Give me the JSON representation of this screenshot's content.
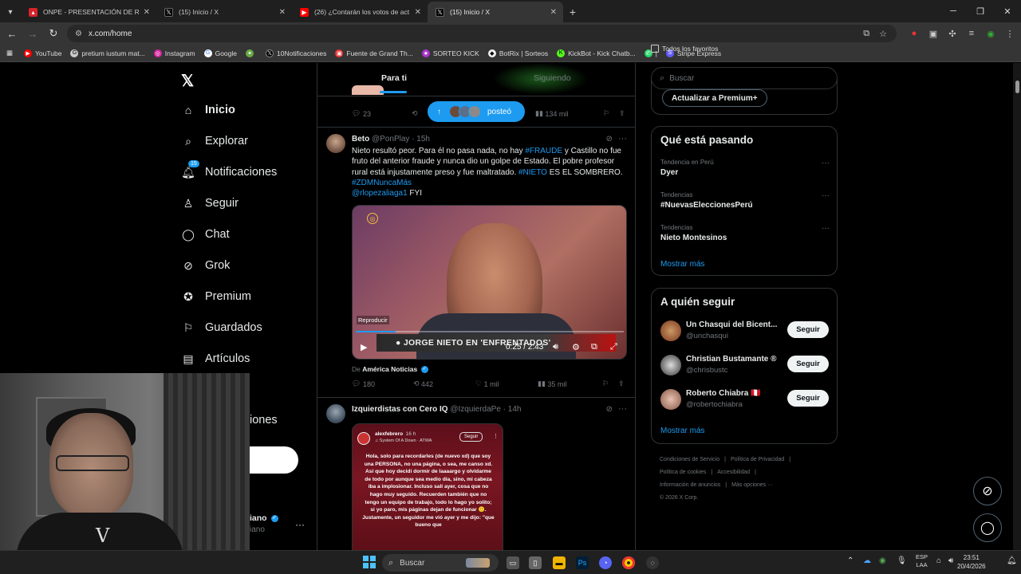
{
  "browser": {
    "tabs": [
      {
        "title": "ONPE - PRESENTACIÓN DE RES",
        "color": "#d8232a"
      },
      {
        "title": "(15) Inicio / X",
        "color": "#000000"
      },
      {
        "title": "(26) ¿Contarán los votos de act",
        "color": "#ff0000"
      },
      {
        "title": "(15) Inicio / X",
        "color": "#000000"
      }
    ],
    "active_tab": 3,
    "url": "x.com/home",
    "bookmarks": [
      "YouTube",
      "pretium iustum mat...",
      "Instagram",
      "Google",
      "",
      "10Notificaciones",
      "Fuente de Grand Th...",
      "SORTEO KICK",
      "BotRix | Sorteos",
      "KickBot - Kick Chatb...",
      "|",
      "Stripe Express"
    ],
    "all_bookmarks": "Todos los favoritos"
  },
  "nav": {
    "items": [
      {
        "label": "Inicio",
        "icon": "home-icon"
      },
      {
        "label": "Explorar",
        "icon": "search-icon"
      },
      {
        "label": "Notificaciones",
        "icon": "bell-icon"
      },
      {
        "label": "Seguir",
        "icon": "follow-icon"
      },
      {
        "label": "Chat",
        "icon": "chat-icon"
      },
      {
        "label": "Grok",
        "icon": "grok-icon"
      },
      {
        "label": "Premium",
        "icon": "premium-icon"
      },
      {
        "label": "Guardados",
        "icon": "bookmark-icon"
      },
      {
        "label": "Artículos",
        "icon": "articles-icon"
      },
      {
        "label": "iones",
        "icon": ""
      }
    ],
    "notif_badge": "15",
    "user_name_fragment": "iano",
    "user_handle_fragment": "iano"
  },
  "feed": {
    "tabs": [
      "Para ti",
      "Siguiendo"
    ],
    "prev_actions": {
      "replies": "23",
      "views": "134 mil"
    },
    "posted_pill": "posteó",
    "tweet1": {
      "name": "Beto",
      "handle": "@PonPlay · 15h",
      "text_1": "Nieto resultó peor. Para él no pasa nada, no hay ",
      "tag_1": "#FRAUDE",
      "text_2": " y Castillo no fue fruto del anterior fraude y nunca dio un golpe de Estado. El pobre profesor rural está injustamente preso y fue maltratado. ",
      "tag_2": "#NIETO",
      "text_3": " ES EL SOMBRERO.",
      "tag_3": "#ZDMNuncaMás",
      "mention": "@rlopezaliaga1",
      "text_4": " FYI",
      "video": {
        "label": "Reproducir",
        "chyron": "● JORGE NIETO EN 'ENFRENTADOS'",
        "time": "0:25 / 2:43",
        "progress": 0.15
      },
      "source_prefix": "De ",
      "source": "América Noticias",
      "actions": {
        "replies": "180",
        "reposts": "442",
        "likes": "1 mil",
        "views": "35 mil"
      }
    },
    "tweet2": {
      "name": "Izquierdistas con Cero IQ",
      "handle": "@IzquierdaPe · 14h",
      "card_user": "alexfebrero",
      "card_time": "16 h",
      "card_song": "System Of A Down · ATWA",
      "card_follow": "Seguir",
      "card_text": "Hola, solo para recordarles (de nuevo xd) que soy una PERSONA, no una página, o sea, me canso xd. Así que hoy decidí dormir de laaaargo y olvidarme de todo por aunque sea medio día, sino, mi cabeza iba a implosionar. Incluso salí ayer, cosa que no hago muy seguido. Recuerden también que no tengo un equipo de trabajo, todo lo hago yo solito; si yo paro, mis páginas dejan de funcionar 🙂. Justamente, un seguidor me vió ayer y me dijo: \"que bueno que"
    }
  },
  "sidebar": {
    "search_placeholder": "Buscar",
    "premium_button": "Actualizar a Premium+",
    "trends_title": "Qué está pasando",
    "trends": [
      {
        "category": "Tendencia en Perú",
        "name": "Dyer"
      },
      {
        "category": "Tendencias",
        "name": "#NuevasEleccionesPerú"
      },
      {
        "category": "Tendencias",
        "name": "Nieto Montesinos"
      }
    ],
    "show_more": "Mostrar más",
    "who_title": "A quién seguir",
    "who": [
      {
        "name": "Un Chasqui del Bicent...",
        "handle": "@unchasqui",
        "button": "Seguir"
      },
      {
        "name": "Christian Bustamante ®",
        "handle": "@chrisbustc",
        "button": "Seguir"
      },
      {
        "name": "Roberto Chiabra 🇵🇪",
        "handle": "@robertochiabra",
        "button": "Seguir"
      }
    ],
    "who_more": "Mostrar más",
    "footer": [
      "Condiciones de Servicio",
      "|",
      "Política de Privacidad",
      "|",
      "Política de cookies",
      "|",
      "Accesibilidad",
      "|",
      "Información de anuncios",
      "|",
      "Más opciones ···",
      "© 2026 X Corp."
    ]
  },
  "taskbar": {
    "search": "Buscar",
    "lang_1": "ESP",
    "lang_2": "LAA",
    "time": "23:51",
    "date": "20/4/2026"
  },
  "colors": {
    "accent": "#1d9bf0",
    "bg": "#000000",
    "border": "#2f3336",
    "muted": "#71767b"
  }
}
